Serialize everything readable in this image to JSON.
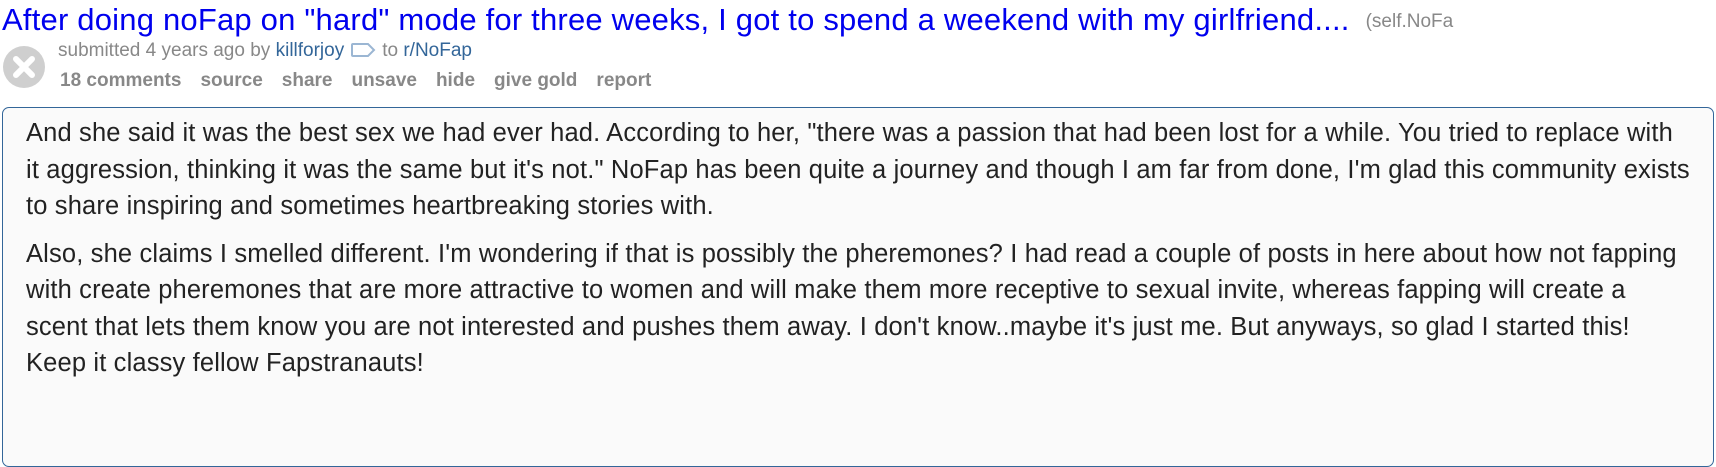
{
  "post": {
    "title": "After doing noFap on \"hard\" mode for three weeks, I got to spend a weekend with my girlfriend....",
    "domain": "(self.NoFa"
  },
  "tagline": {
    "submitted": "submitted",
    "age": "4 years ago",
    "by": "by",
    "author": "killforjoy",
    "to": "to",
    "subreddit": "r/NoFap"
  },
  "buttons": {
    "comments": "18 comments",
    "source": "source",
    "share": "share",
    "unsave": "unsave",
    "hide": "hide",
    "give_gold": "give gold",
    "report": "report"
  },
  "selftext": {
    "paragraphs": [
      "And she said it was the best sex we had ever had. According to her, \"there was a passion that had been lost for a while. You tried to replace with it aggression, thinking it was the same but it's not.\" NoFap has been quite a journey and though I am far from done, I'm glad this community exists to share inspiring and sometimes heartbreaking stories with.",
      "Also, she claims I smelled different. I'm wondering if that is possibly the pheremones? I had read a couple of posts in here about how not fapping with create pheremones that are more attractive to women and will make them more receptive to sexual invite, whereas fapping will create a scent that lets them know you are not interested and pushes them away. I don't know..maybe it's just me. But anyways, so glad I started this! Keep it classy fellow Fapstranauts!"
    ]
  },
  "colors": {
    "title_link": "#0000ee",
    "meta_gray": "#888888",
    "user_link": "#336699",
    "body_text": "#222222",
    "selftext_border": "#336699",
    "selftext_bg": "#fafafa"
  },
  "icons": {
    "hide": "close-circle-icon",
    "tag": "tag-icon"
  }
}
